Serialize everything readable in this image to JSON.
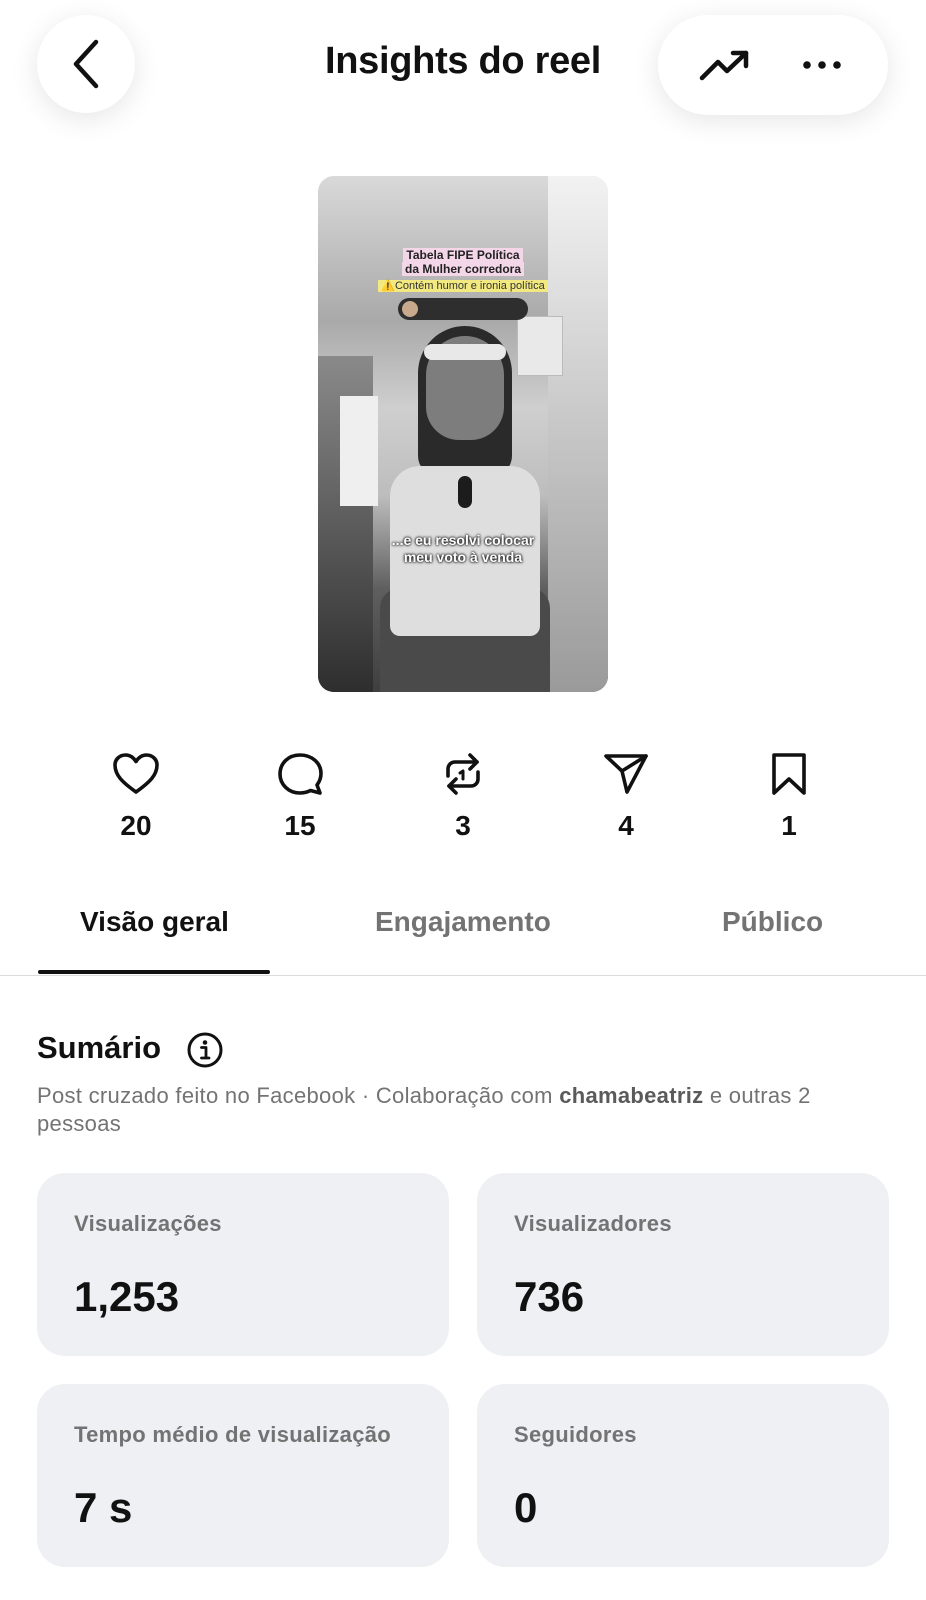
{
  "header": {
    "title": "Insights do reel"
  },
  "thumbnail": {
    "caption_title_line1": "Tabela FIPE Política",
    "caption_title_line2": "da Mulher corredora",
    "caption_warning": "⚠️Contém humor e ironia política",
    "subtitle_line1": "...e eu resolvi colocar",
    "subtitle_line2": "meu voto à venda"
  },
  "stats": {
    "likes": "20",
    "comments": "15",
    "reposts": "3",
    "shares": "4",
    "saves": "1"
  },
  "tabs": {
    "overview": "Visão geral",
    "engagement": "Engajamento",
    "audience": "Público"
  },
  "summary": {
    "title": "Sumário",
    "desc_prefix": "Post cruzado feito no Facebook · Colaboração com ",
    "desc_user": "chamabeatriz",
    "desc_suffix": " e outras 2 pessoas"
  },
  "cards": [
    {
      "label": "Visualizações",
      "value": "1,253"
    },
    {
      "label": "Visualizadores",
      "value": "736"
    },
    {
      "label": "Tempo médio de visualização",
      "value": "7 s"
    },
    {
      "label": "Seguidores",
      "value": "0"
    }
  ]
}
